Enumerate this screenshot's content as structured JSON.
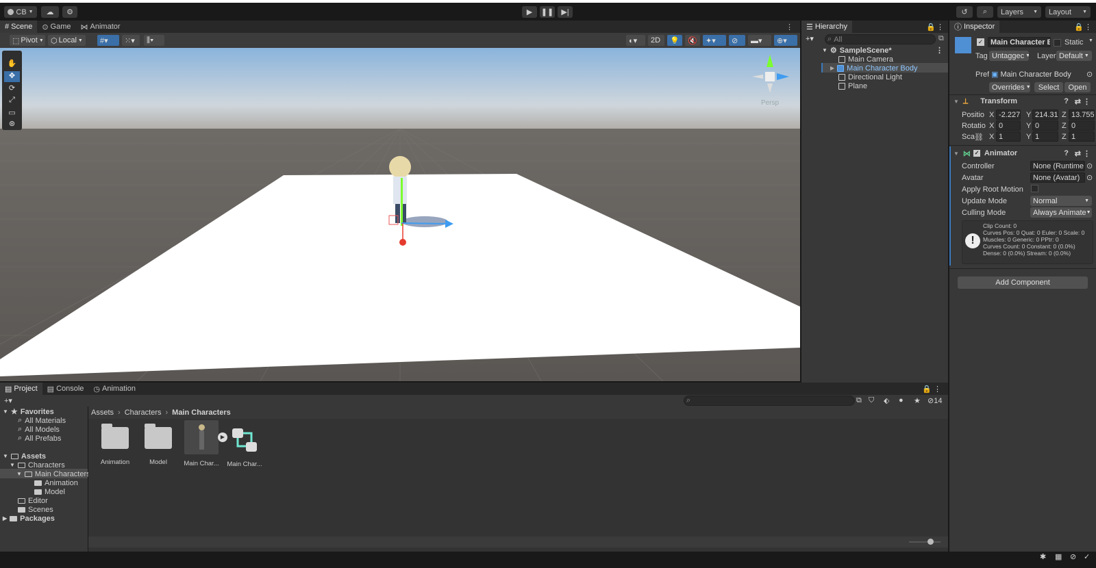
{
  "topbar": {
    "account": "CB",
    "layers_label": "Layers",
    "layout_label": "Layout"
  },
  "scene_panel": {
    "tabs": [
      {
        "label": "Scene",
        "icon": "hash-icon"
      },
      {
        "label": "Game",
        "icon": "gamepad-icon"
      },
      {
        "label": "Animator",
        "icon": "animator-icon"
      }
    ],
    "pivot": "Pivot",
    "local": "Local",
    "mode_2d": "2D",
    "persp": "Persp"
  },
  "hierarchy": {
    "title": "Hierarchy",
    "search_placeholder": "All",
    "scene": "SampleScene*",
    "items": [
      "Main Camera",
      "Main Character Body",
      "Directional Light",
      "Plane"
    ]
  },
  "inspector": {
    "title": "Inspector",
    "object_name": "Main Character B",
    "static_label": "Static",
    "tag_label": "Tag",
    "tag_value": "Untaggec",
    "layer_label": "Layer",
    "layer_value": "Default",
    "prefab_label": "Prefab",
    "prefab_value": "Main Character Body",
    "overrides": "Overrides",
    "select": "Select",
    "open": "Open",
    "transform": {
      "title": "Transform",
      "position_label": "Positio",
      "rotation_label": "Rotatio",
      "scale_label": "Sca",
      "position": {
        "x": "-2.227",
        "y": "214.31",
        "z": "13.755"
      },
      "rotation": {
        "x": "0",
        "y": "0",
        "z": "0"
      },
      "scale": {
        "x": "1",
        "y": "1",
        "z": "1"
      }
    },
    "animator": {
      "title": "Animator",
      "controller_label": "Controller",
      "controller_value": "None (Runtime A",
      "avatar_label": "Avatar",
      "avatar_value": "None (Avatar)",
      "root_motion_label": "Apply Root Motion",
      "update_mode_label": "Update Mode",
      "update_mode_value": "Normal",
      "culling_mode_label": "Culling Mode",
      "culling_mode_value": "Always Animate",
      "info": [
        "Clip Count: 0",
        "Curves Pos: 0 Quat: 0 Euler: 0 Scale: 0",
        "Muscles: 0 Generic: 0 PPtr: 0",
        "Curves Count: 0 Constant: 0 (0.0%)",
        "Dense: 0 (0.0%) Stream: 0 (0.0%)"
      ]
    },
    "add_component": "Add Component"
  },
  "project_panel": {
    "tabs": [
      {
        "label": "Project",
        "icon": "folder-icon"
      },
      {
        "label": "Console",
        "icon": "console-icon"
      },
      {
        "label": "Animation",
        "icon": "clock-icon"
      }
    ],
    "hidden_count": "14",
    "favorites": {
      "title": "Favorites",
      "items": [
        "All Materials",
        "All Models",
        "All Prefabs"
      ]
    },
    "tree": {
      "assets": "Assets",
      "characters": "Characters",
      "main_characters": "Main Characters",
      "animation": "Animation",
      "model": "Model",
      "editor": "Editor",
      "scenes": "Scenes",
      "packages": "Packages"
    },
    "breadcrumb": [
      "Assets",
      "Characters",
      "Main Characters"
    ],
    "assets": [
      "Animation",
      "Model",
      "Main Char...",
      "Main Char..."
    ]
  }
}
